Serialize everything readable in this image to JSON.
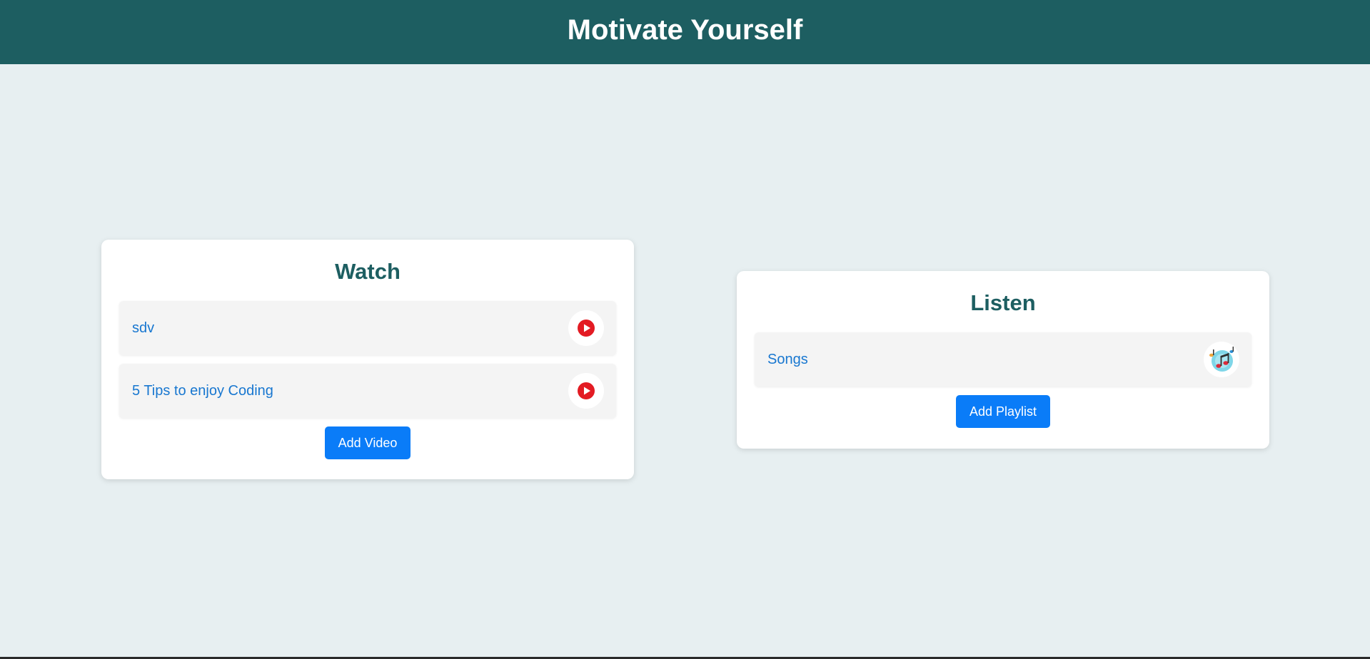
{
  "header": {
    "title": "Motivate Yourself"
  },
  "watch": {
    "title": "Watch",
    "items": [
      {
        "label": "sdv",
        "icon": "play-icon"
      },
      {
        "label": "5 Tips to enjoy Coding",
        "icon": "play-icon"
      }
    ],
    "add_button_label": "Add Video"
  },
  "listen": {
    "title": "Listen",
    "items": [
      {
        "label": "Songs",
        "icon": "music-notes-icon"
      }
    ],
    "add_button_label": "Add Playlist"
  },
  "colors": {
    "header_bg": "#1d5e61",
    "page_bg": "#e7eff1",
    "card_title": "#1d5e61",
    "link": "#1877d0",
    "button": "#0a7cf8",
    "play_red": "#e31b23"
  }
}
